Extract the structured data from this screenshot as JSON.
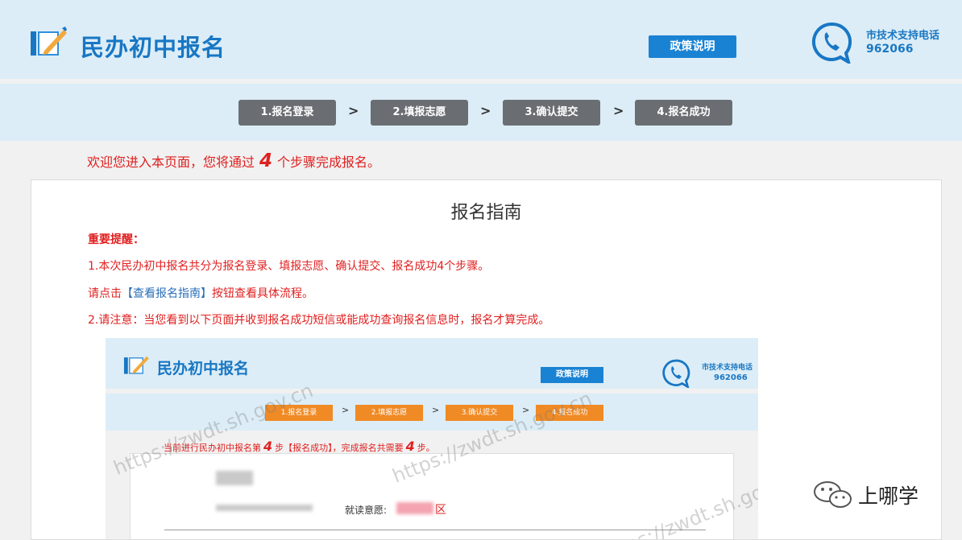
{
  "header": {
    "title": "民办初中报名",
    "policy_button": "政策说明",
    "support_label": "市技术支持电话",
    "support_number": "962066"
  },
  "steps": [
    {
      "label": "1.报名登录"
    },
    {
      "label": "2.填报志愿"
    },
    {
      "label": "3.确认提交"
    },
    {
      "label": "4.报名成功"
    }
  ],
  "step_separator": ">",
  "welcome": {
    "prefix": "欢迎您进入本页面，您将通过",
    "count": "4",
    "suffix": "个步骤完成报名。"
  },
  "guide": {
    "title": "报名指南",
    "important_label": "重要提醒：",
    "line1": "1.本次民办初中报名共分为报名登录、填报志愿、确认提交、报名成功4个步骤。",
    "line2_prefix": "请点击",
    "line2_link": "【查看报名指南】",
    "line2_suffix": "按钮查看具体流程。",
    "line3": "2.请注意：当您看到以下页面并收到报名成功短信或能成功查询报名信息时，报名才算完成。"
  },
  "embedded": {
    "title": "民办初中报名",
    "policy_button": "政策说明",
    "support_label": "市技术支持电话",
    "support_number": "962066",
    "steps": [
      "1.报名登录",
      "2.填报志愿",
      "3.确认提交",
      "4.报名成功"
    ],
    "notice_prefix": "当前进行民办初中报名第",
    "notice_step": "4",
    "notice_middle": "步【报名成功】，完成报名共需要",
    "notice_total": "4",
    "notice_suffix": "步。",
    "intention_label": "就读意愿:",
    "district": "区",
    "watermark": "https://zwdt.sh.gov.cn"
  },
  "badge": {
    "text": "上哪学"
  },
  "colors": {
    "header_bg": "#dcedf7",
    "brand_blue": "#1877c4",
    "step_gray": "#6a6e73",
    "step_orange": "#f08a24",
    "alert_red": "#e02020"
  },
  "icons": {
    "logo": "notebook-pen-icon",
    "phone": "phone-chat-icon",
    "badge": "wechat-icon"
  }
}
